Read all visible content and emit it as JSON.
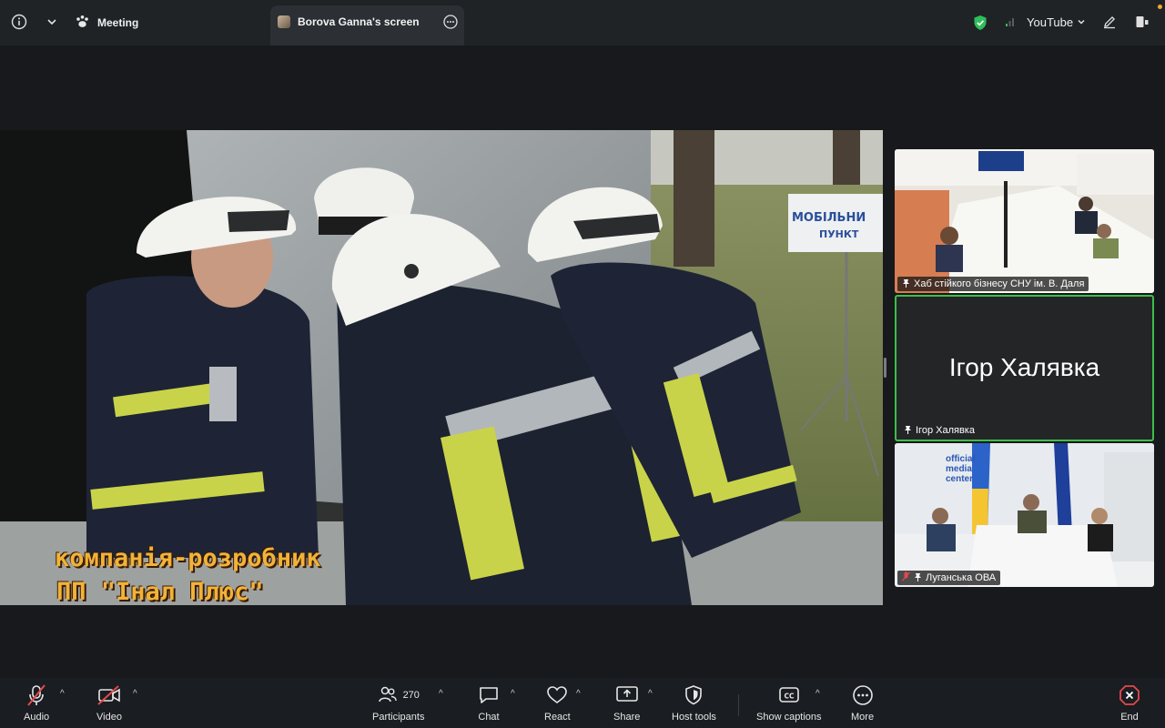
{
  "topbar": {
    "meeting_label": "Meeting",
    "share_tab_label": "Borova Ganna's screen",
    "youtube_label": "YouTube"
  },
  "shared_screen": {
    "caption_line1": "компанія-розробник",
    "caption_line2": "ПП \"Інал Плюс\"",
    "sign_text_1": "МОБІЛЬНИ",
    "sign_text_2": "ПУНКТ"
  },
  "participants_panel": {
    "tiles": [
      {
        "label": "Хаб стійкого бізнесу СНУ ім. В. Даля",
        "muted": false
      },
      {
        "name_display": "Ігор Халявка",
        "label": "Ігор Халявка",
        "muted": false,
        "active_speaker": true
      },
      {
        "label": "Луганська ОВА",
        "muted": true,
        "wall_text_1": "official",
        "wall_text_2": "media",
        "wall_text_3": "center"
      }
    ]
  },
  "toolbar": {
    "audio_label": "Audio",
    "video_label": "Video",
    "participants_count": "270",
    "participants_label": "Participants",
    "chat_label": "Chat",
    "react_label": "React",
    "share_label": "Share",
    "host_tools_label": "Host tools",
    "captions_label": "Show captions",
    "more_label": "More",
    "end_label": "End"
  },
  "colors": {
    "accent_green": "#3fbe4a",
    "end_red": "#e5484d",
    "caption_orange": "#f0b33a"
  }
}
